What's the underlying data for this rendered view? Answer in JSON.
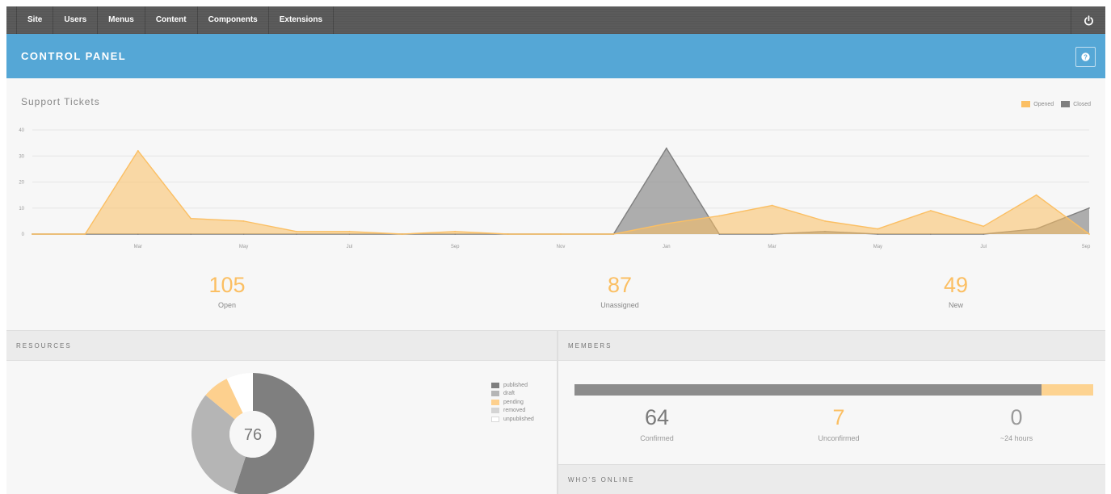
{
  "nav": {
    "items": [
      "Site",
      "Users",
      "Menus",
      "Content",
      "Components",
      "Extensions"
    ],
    "power_icon": "power-icon"
  },
  "header": {
    "title": "CONTROL PANEL",
    "help_icon": "help-icon"
  },
  "support": {
    "title": "Support Tickets",
    "legend": [
      {
        "name": "Opened",
        "color": "#fbbf63"
      },
      {
        "name": "Closed",
        "color": "#7f7f7f"
      }
    ],
    "stats": [
      {
        "value": "105",
        "label": "Open"
      },
      {
        "value": "87",
        "label": "Unassigned"
      },
      {
        "value": "49",
        "label": "New"
      }
    ]
  },
  "chart_data": {
    "type": "area",
    "x": [
      0,
      1,
      2,
      3,
      4,
      5,
      6,
      7,
      8,
      9,
      10,
      11,
      12,
      13,
      14,
      15,
      16,
      17,
      18,
      19,
      20
    ],
    "x_tick_labels": [
      {
        "x": 2,
        "label": "Mar"
      },
      {
        "x": 4,
        "label": "May"
      },
      {
        "x": 6,
        "label": "Jul"
      },
      {
        "x": 8,
        "label": "Sep"
      },
      {
        "x": 10,
        "label": "Nov"
      },
      {
        "x": 12,
        "label": "Jan"
      },
      {
        "x": 14,
        "label": "Mar"
      },
      {
        "x": 16,
        "label": "May"
      },
      {
        "x": 18,
        "label": "Jul"
      },
      {
        "x": 20,
        "label": "Sep"
      }
    ],
    "y_ticks": [
      0,
      10,
      20,
      30,
      40
    ],
    "ylim": [
      0,
      40
    ],
    "grid": true,
    "legend_position": "top-right",
    "series": [
      {
        "name": "Opened",
        "color": "#fbbf63",
        "values": [
          0,
          0,
          32,
          6,
          5,
          1,
          1,
          0,
          1,
          0,
          0,
          0,
          4,
          7,
          11,
          5,
          2,
          9,
          3,
          15,
          0
        ]
      },
      {
        "name": "Closed",
        "color": "#7f7f7f",
        "values": [
          0,
          0,
          0,
          0,
          0,
          0,
          0,
          0,
          0,
          0,
          0,
          0,
          33,
          0,
          0,
          1,
          0,
          0,
          0,
          2,
          10
        ]
      }
    ]
  },
  "resources": {
    "title": "RESOURCES",
    "total": "76",
    "legend": [
      {
        "name": "published",
        "value": 55,
        "color": "#7f7f7f"
      },
      {
        "name": "draft",
        "value": 31,
        "color": "#b5b5b5"
      },
      {
        "name": "pending",
        "value": 7,
        "color": "#fdd08e"
      },
      {
        "name": "removed",
        "value": 0,
        "color": "#d4d4d4"
      },
      {
        "name": "unpublished",
        "value": 7,
        "color": "#ffffff"
      }
    ]
  },
  "members": {
    "title": "MEMBERS",
    "bar": {
      "confirmed_fraction": 0.9,
      "unconfirmed_fraction": 0.1
    },
    "stats": [
      {
        "value": "64",
        "label": "Confirmed",
        "color": "#7a7a7a"
      },
      {
        "value": "7",
        "label": "Unconfirmed",
        "color": "#fbbf63"
      },
      {
        "value": "0",
        "label": "~24 hours",
        "color": "#9a9a9a"
      }
    ]
  },
  "online": {
    "title": "WHO'S ONLINE"
  }
}
